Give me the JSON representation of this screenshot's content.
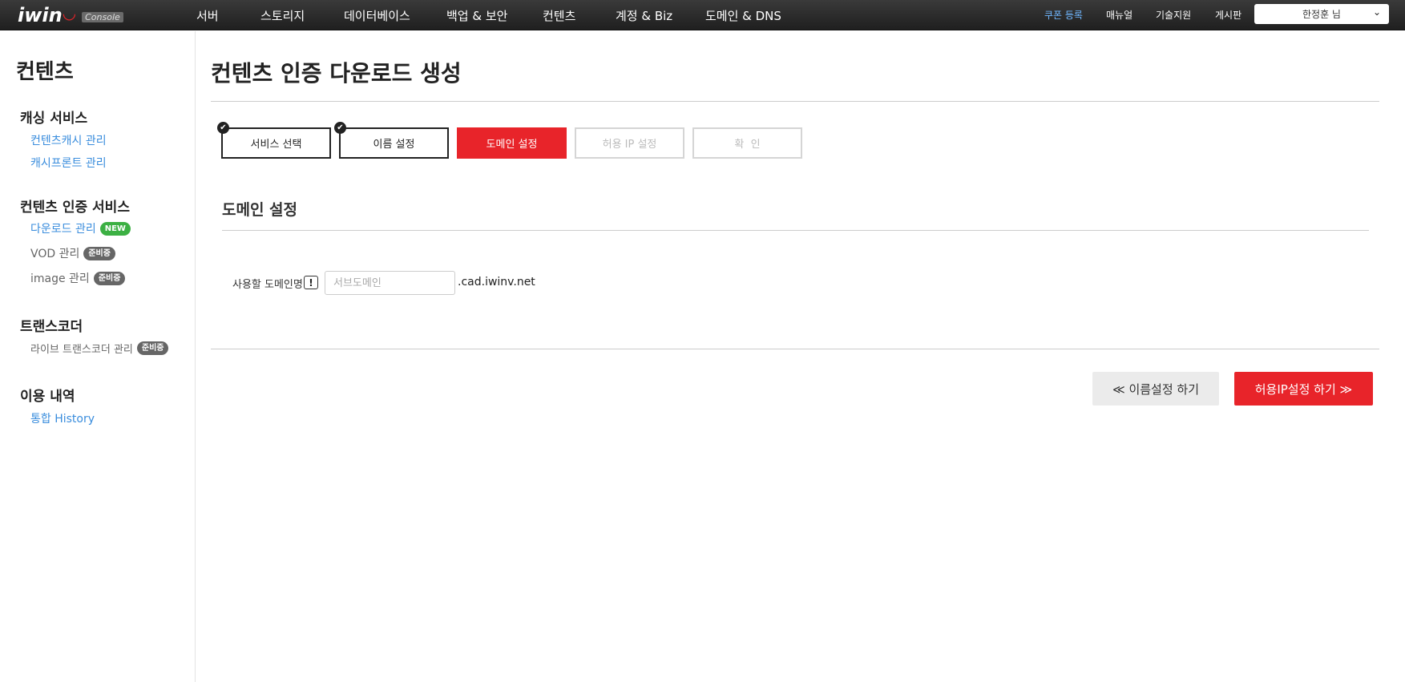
{
  "header": {
    "logo_text": "iwin",
    "logo_badge": "Console",
    "nav": [
      "서버",
      "스토리지",
      "데이터베이스",
      "백업 & 보안",
      "컨텐츠",
      "계정 & Biz",
      "도메인 & DNS"
    ],
    "util": {
      "coupon": "쿠폰 등록",
      "manual": "매뉴얼",
      "support": "기술지원",
      "board": "게시판"
    },
    "user": "한정훈 님"
  },
  "sidebar": {
    "title": "컨텐츠",
    "groups": [
      {
        "title": "캐싱 서비스",
        "items": [
          {
            "label": "컨텐츠캐시 관리"
          },
          {
            "label": "캐시프론트 관리"
          }
        ]
      },
      {
        "title": "컨텐츠 인증 서비스",
        "items": [
          {
            "label": "다운로드 관리",
            "badge": "NEW"
          },
          {
            "label": "VOD 관리",
            "badge": "준비중"
          },
          {
            "label": "image 관리",
            "badge": "준비중"
          }
        ]
      },
      {
        "title": "트랜스코더",
        "items": [
          {
            "label": "라이브 트랜스코더 관리",
            "badge": "준비중"
          }
        ]
      },
      {
        "title": "이용 내역",
        "items": [
          {
            "label": "통합 History"
          }
        ]
      }
    ]
  },
  "main": {
    "title": "컨텐츠 인증 다운로드 생성",
    "steps": [
      {
        "label": "서비스 선택",
        "state": "done"
      },
      {
        "label": "이름 설정",
        "state": "done"
      },
      {
        "label": "도메인 설정",
        "state": "active"
      },
      {
        "label": "허용 IP 설정",
        "state": "pending"
      },
      {
        "label": "확  인",
        "state": "pending"
      }
    ],
    "section_title": "도메인 설정",
    "field": {
      "label": "사용할 도메인명",
      "info_glyph": "!",
      "value": "",
      "placeholder": "서브도메인",
      "suffix": ".cad.iwinv.net"
    },
    "buttons": {
      "prev": "≪ 이름설정 하기",
      "next": "허용IP설정 하기 ≫"
    }
  },
  "colors": {
    "accent_red": "#e8242a",
    "link_blue": "#3a8ddd",
    "new_badge": "#3cb043",
    "prep_badge": "#666666"
  }
}
